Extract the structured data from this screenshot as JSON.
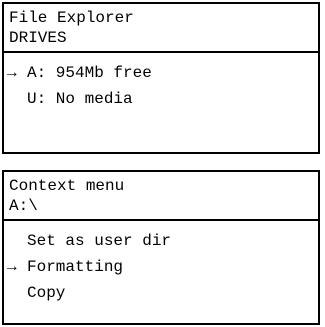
{
  "file_explorer": {
    "title": "File Explorer",
    "subtitle": "DRIVES",
    "items": [
      {
        "label": "A: 954Mb free",
        "selected": true
      },
      {
        "label": "U: No media",
        "selected": false
      }
    ]
  },
  "context_menu": {
    "title": "Context menu",
    "subtitle": "A:\\",
    "items": [
      {
        "label": "Set as user dir",
        "selected": false
      },
      {
        "label": "Formatting",
        "selected": true
      },
      {
        "label": "Copy",
        "selected": false
      }
    ]
  },
  "cursor_glyph": "→"
}
